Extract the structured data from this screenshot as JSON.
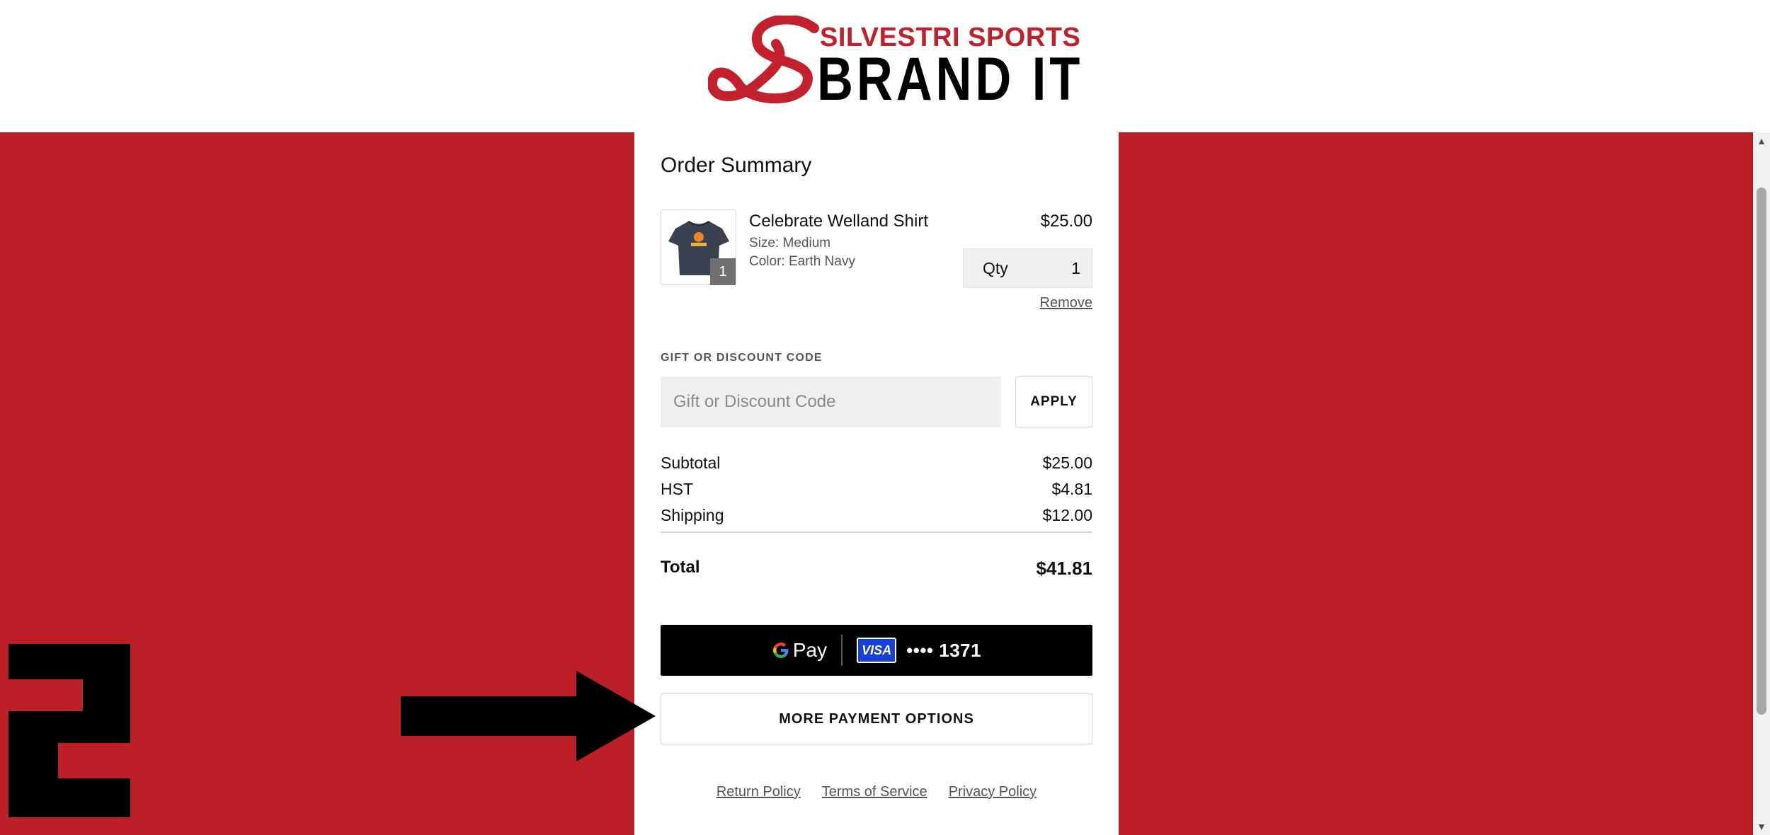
{
  "header": {
    "logo_top": "SILVESTRI SPORTS",
    "logo_bottom": "BRAND IT"
  },
  "summary": {
    "title": "Order Summary",
    "item": {
      "name": "Celebrate Welland Shirt",
      "size": "Size: Medium",
      "color": "Color: Earth Navy",
      "price": "$25.00",
      "badge": "1",
      "qty_label": "Qty",
      "qty_value": "1",
      "remove_label": "Remove"
    },
    "discount": {
      "label": "GIFT OR DISCOUNT CODE",
      "placeholder": "Gift or Discount Code",
      "apply_label": "APPLY"
    },
    "rows": {
      "subtotal_label": "Subtotal",
      "subtotal_value": "$25.00",
      "hst_label": "HST",
      "hst_value": "$4.81",
      "shipping_label": "Shipping",
      "shipping_value": "$12.00",
      "total_label": "Total",
      "total_value": "$41.81"
    },
    "payment": {
      "gpay_label": "Pay",
      "card_brand": "VISA",
      "card_number": "•••• 1371",
      "more_label": "MORE PAYMENT OPTIONS"
    },
    "footer": {
      "return_policy": "Return Policy",
      "terms": "Terms of Service",
      "privacy": "Privacy Policy"
    }
  },
  "annotation": {
    "step_number": "2"
  },
  "colors": {
    "brand_red": "#bb2027",
    "logo_red": "#c3202d",
    "visa_blue": "#1a3fd6"
  }
}
